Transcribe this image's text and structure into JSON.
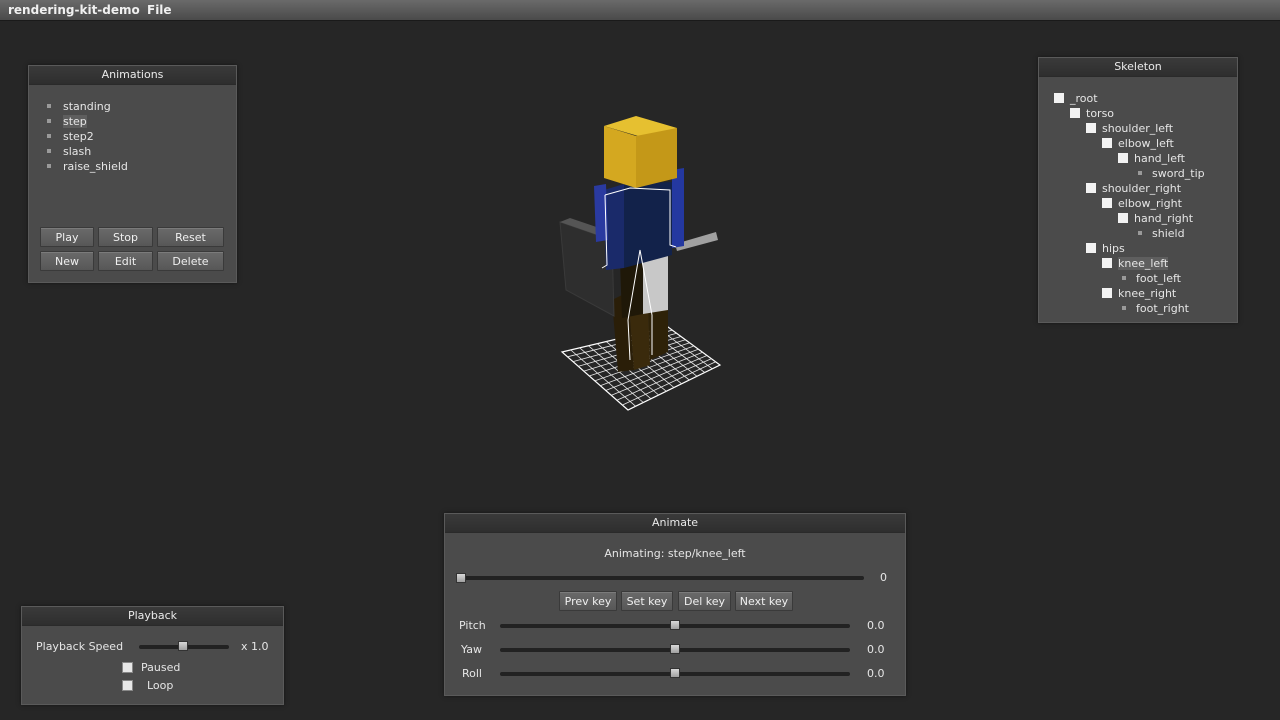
{
  "app": {
    "title": "rendering-kit-demo",
    "menu_file": "File"
  },
  "animations": {
    "title": "Animations",
    "items": [
      "standing",
      "step",
      "step2",
      "slash",
      "raise_shield"
    ],
    "selected": "step",
    "buttons": {
      "play": "Play",
      "stop": "Stop",
      "reset": "Reset",
      "new": "New",
      "edit": "Edit",
      "delete": "Delete"
    }
  },
  "skeleton": {
    "title": "Skeleton",
    "nodes": [
      "_root",
      "torso",
      "shoulder_left",
      "elbow_left",
      "hand_left",
      "sword_tip",
      "shoulder_right",
      "elbow_right",
      "hand_right",
      "shield",
      "hips",
      "knee_left",
      "foot_left",
      "knee_right",
      "foot_right"
    ],
    "selected": "knee_left"
  },
  "animate": {
    "title": "Animate",
    "status": "Animating: step/knee_left",
    "frame_value": "0",
    "buttons": {
      "prev": "Prev key",
      "set": "Set key",
      "del": "Del key",
      "next": "Next key"
    },
    "pitch_label": "Pitch",
    "pitch_value": "0.0",
    "yaw_label": "Yaw",
    "yaw_value": "0.0",
    "roll_label": "Roll",
    "roll_value": "0.0"
  },
  "playback": {
    "title": "Playback",
    "speed_label": "Playback Speed",
    "speed_value": "x 1.0",
    "speed_fraction": 0.5,
    "paused_label": "Paused",
    "paused": false,
    "loop_label": "Loop",
    "loop": false
  },
  "colors": {
    "background": "#262626",
    "panel": "#4b4b4b",
    "head": "#d4a820",
    "torso": "#1a2a6a",
    "shield": "#2e2e2e"
  }
}
